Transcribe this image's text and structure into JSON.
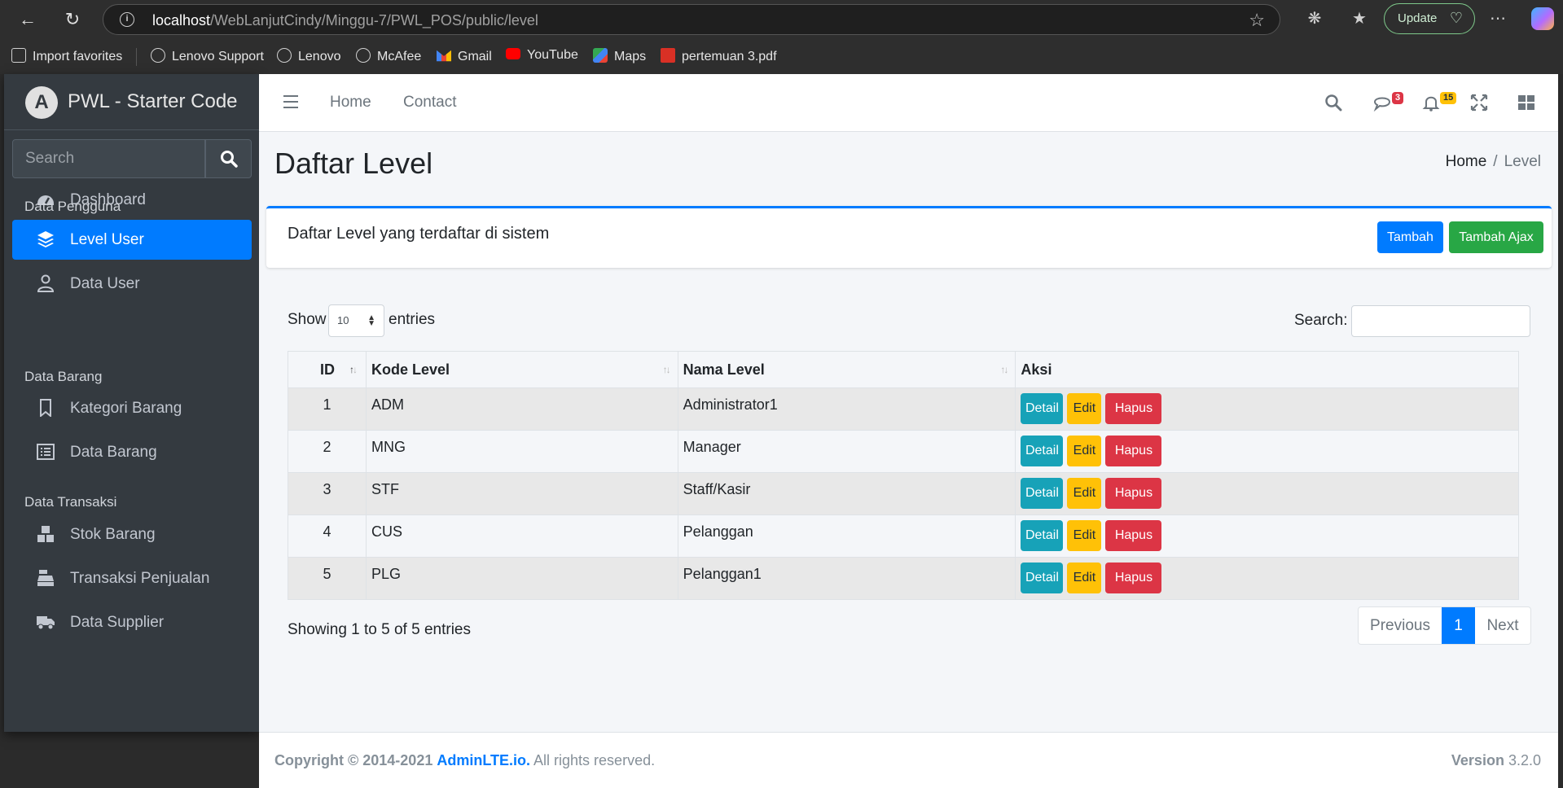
{
  "browser": {
    "url_host": "localhost",
    "url_path": "/WebLanjutCindy/Minggu-7/PWL_POS/public/level",
    "update_label": "Update",
    "bookmarks": [
      "Import favorites",
      "Lenovo Support",
      "Lenovo",
      "McAfee",
      "Gmail",
      "YouTube",
      "Maps",
      "pertemuan 3.pdf"
    ]
  },
  "sidebar": {
    "brand": "PWL - Starter Code",
    "search_placeholder": "Search",
    "items": [
      {
        "label": "Dashboard",
        "icon": "dashboard-icon"
      },
      {
        "header": "Data Pengguna"
      },
      {
        "label": "Level User",
        "icon": "layers-icon",
        "active": true
      },
      {
        "label": "Data User",
        "icon": "user-icon"
      },
      {
        "header": "Data Barang"
      },
      {
        "label": "Kategori Barang",
        "icon": "bookmark-icon"
      },
      {
        "label": "Data Barang",
        "icon": "list-icon"
      },
      {
        "header": "Data Transaksi"
      },
      {
        "label": "Stok Barang",
        "icon": "cubes-icon"
      },
      {
        "label": "Transaksi Penjualan",
        "icon": "cash-register-icon"
      },
      {
        "label": "Data Supplier",
        "icon": "truck-icon"
      }
    ]
  },
  "topnav": {
    "home": "Home",
    "contact": "Contact",
    "messages_count": "3",
    "notifications_count": "15"
  },
  "page": {
    "title": "Daftar Level",
    "breadcrumb_home": "Home",
    "breadcrumb_sep": "/",
    "breadcrumb_current": "Level",
    "card_title": "Daftar Level yang terdaftar di sistem",
    "btn_tambah": "Tambah",
    "btn_tambah_ajax": "Tambah Ajax"
  },
  "datatable": {
    "show_label": "Show",
    "length_value": "10",
    "entries_label": "entries",
    "search_label": "Search:",
    "columns": [
      "ID",
      "Kode Level",
      "Nama Level",
      "Aksi"
    ],
    "rows": [
      {
        "id": "1",
        "kode": "ADM",
        "nama": "Administrator1"
      },
      {
        "id": "2",
        "kode": "MNG",
        "nama": "Manager"
      },
      {
        "id": "3",
        "kode": "STF",
        "nama": "Staff/Kasir"
      },
      {
        "id": "4",
        "kode": "CUS",
        "nama": "Pelanggan"
      },
      {
        "id": "5",
        "kode": "PLG",
        "nama": "Pelanggan1"
      }
    ],
    "action_labels": {
      "detail": "Detail",
      "edit": "Edit",
      "hapus": "Hapus"
    },
    "info": "Showing 1 to 5 of 5 entries",
    "pager": {
      "previous": "Previous",
      "page": "1",
      "next": "Next"
    }
  },
  "footer": {
    "copyright": "Copyright © 2014-2021",
    "link": "AdminLTE.io.",
    "rights": "All rights reserved.",
    "version_label": "Version",
    "version": "3.2.0"
  }
}
